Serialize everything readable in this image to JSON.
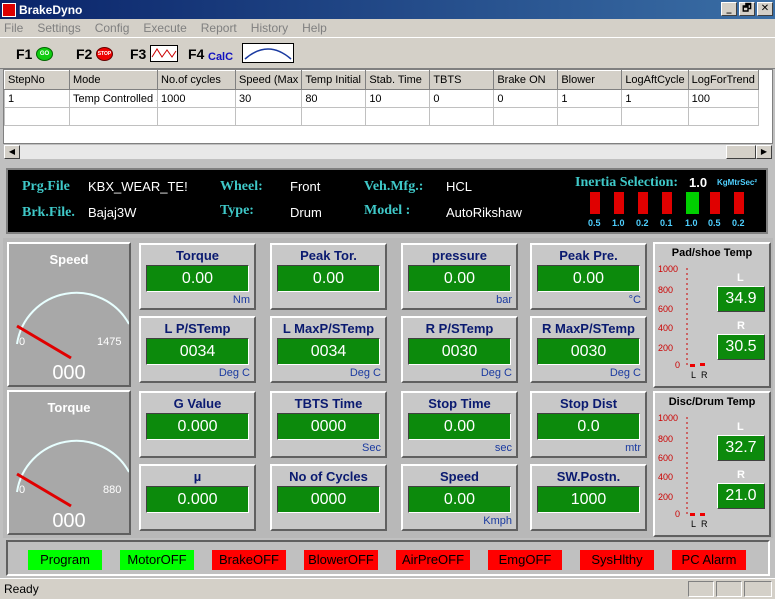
{
  "window": {
    "title": "BrakeDyno",
    "min": "_",
    "max": "🗗",
    "close": "✕"
  },
  "menu": [
    "File",
    "Settings",
    "Config",
    "Execute",
    "Report",
    "History",
    "Help"
  ],
  "toolbar": {
    "f1": "F1",
    "f1_icon": "GO",
    "f2": "F2",
    "f2_icon": "STOP",
    "f3": "F3",
    "f4": "F4",
    "f4_icon": "CalC"
  },
  "grid": {
    "columns": [
      "StepNo",
      "Mode",
      "No.of cycles",
      "Speed (Max",
      "Temp Initial",
      "Stab. Time",
      "TBTS",
      "Brake ON",
      "Blower",
      "LogAftCycle",
      "LogForTrend"
    ],
    "rows": [
      [
        "1",
        "Temp Controlled S",
        "1000",
        "30",
        "80",
        "10",
        "0",
        "0",
        "1",
        "1",
        "100"
      ]
    ]
  },
  "info": {
    "prg_label": "Prg.File",
    "prg_value": "KBX_WEAR_TE!",
    "brk_label": "Brk.File.",
    "brk_value": "Bajaj3W",
    "wheel_label": "Wheel:",
    "wheel_value": "Front",
    "type_label": "Type:",
    "type_value": "Drum",
    "mfg_label": "Veh.Mfg.:",
    "mfg_value": "HCL",
    "model_label": "Model :",
    "model_value": "AutoRikshaw",
    "inertia_label": "Inertia Selection:",
    "inertia_value": "1.0",
    "inertia_unit": "KgMtrSec²",
    "inertia_bars": [
      "0.5",
      "1.0",
      "0.2",
      "0.1",
      "1.0",
      "0.5",
      "0.2"
    ]
  },
  "gauges": [
    {
      "title": "Speed",
      "min": "0",
      "max": "1475",
      "value": "000"
    },
    {
      "title": "Torque",
      "min": "0",
      "max": "880",
      "value": "000"
    }
  ],
  "panels": [
    {
      "title": "Torque",
      "value": "0.00",
      "unit": "Nm"
    },
    {
      "title": "Peak Tor.",
      "value": "0.00",
      "unit": ""
    },
    {
      "title": "pressure",
      "value": "0.00",
      "unit": "bar"
    },
    {
      "title": "Peak Pre.",
      "value": "0.00",
      "unit": "°C"
    },
    {
      "title": "L P/STemp",
      "value": "0034",
      "unit": "Deg C"
    },
    {
      "title": "L MaxP/STemp",
      "value": "0034",
      "unit": "Deg C"
    },
    {
      "title": "R P/STemp",
      "value": "0030",
      "unit": "Deg C"
    },
    {
      "title": "R MaxP/STemp",
      "value": "0030",
      "unit": "Deg C"
    },
    {
      "title": "G Value",
      "value": "0.000",
      "unit": ""
    },
    {
      "title": "TBTS Time",
      "value": "0000",
      "unit": "Sec"
    },
    {
      "title": "Stop Time",
      "value": "0.00",
      "unit": "sec"
    },
    {
      "title": "Stop Dist",
      "value": "0.0",
      "unit": "mtr"
    },
    {
      "title": "µ",
      "value": "0.000",
      "unit": ""
    },
    {
      "title": "No of Cycles",
      "value": "0000",
      "unit": ""
    },
    {
      "title": "Speed",
      "value": "0.00",
      "unit": "Kmph"
    },
    {
      "title": "SW.Postn.",
      "value": "1000",
      "unit": ""
    }
  ],
  "temps": [
    {
      "title": "Pad/shoe Temp",
      "ticks": [
        "1000",
        "800",
        "600",
        "400",
        "200",
        "0"
      ],
      "l_label": "L",
      "l_value": "34.9",
      "r_label": "R",
      "r_value": "30.5",
      "axis_l": "L",
      "axis_r": "R"
    },
    {
      "title": "Disc/Drum Temp",
      "ticks": [
        "1000",
        "800",
        "600",
        "400",
        "200",
        "0"
      ],
      "l_label": "L",
      "l_value": "32.7",
      "r_label": "R",
      "r_value": "21.0",
      "axis_l": "L",
      "axis_r": "R"
    }
  ],
  "status_buttons": [
    {
      "label": "Program",
      "color": "#00ff00"
    },
    {
      "label": "MotorOFF",
      "color": "#00ff00"
    },
    {
      "label": "BrakeOFF",
      "color": "#ff0000"
    },
    {
      "label": "BlowerOFF",
      "color": "#ff0000"
    },
    {
      "label": "AirPreOFF",
      "color": "#ff0000"
    },
    {
      "label": "EmgOFF",
      "color": "#ff0000"
    },
    {
      "label": "SysHlthy",
      "color": "#ff0000"
    },
    {
      "label": "PC Alarm",
      "color": "#ff0000"
    }
  ],
  "statusbar": {
    "text": "Ready"
  }
}
